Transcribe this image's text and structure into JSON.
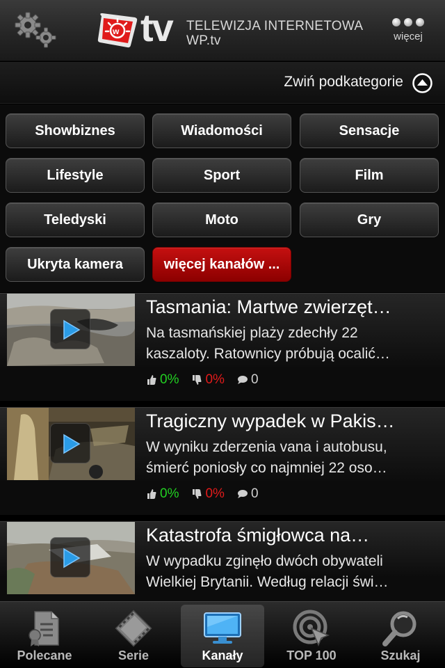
{
  "header": {
    "logo_text_line1": "TELEWIZJA INTERNETOWA",
    "logo_text_line2": "WP.tv",
    "logo_tv": "tv",
    "more_label": "więcej"
  },
  "subcategories": {
    "collapse_label": "Zwiń podkategorie"
  },
  "categories": [
    "Showbiznes",
    "Wiadomości",
    "Sensacje",
    "Lifestyle",
    "Sport",
    "Film",
    "Teledyski",
    "Moto",
    "Gry",
    "Ukryta kamera",
    "więcej kanałów ..."
  ],
  "videos": [
    {
      "title": "Tasmania: Martwe zwierzęt…",
      "desc_line1": "Na tasmańskiej plaży zdechły 22",
      "desc_line2": "kaszaloty. Ratownicy próbują ocalić…",
      "likes": "0%",
      "dislikes": "0%",
      "comments": "0"
    },
    {
      "title": "Tragiczny wypadek w Pakis…",
      "desc_line1": "W wyniku zderzenia vana i autobusu,",
      "desc_line2": "śmierć poniosły co najmniej 22 oso…",
      "likes": "0%",
      "dislikes": "0%",
      "comments": "0"
    },
    {
      "title": "Katastrofa śmigłowca na…",
      "desc_line1": "W wypadku zginęło dwóch obywateli",
      "desc_line2": "Wielkiej Brytanii. Według relacji świ…",
      "likes": "",
      "dislikes": "",
      "comments": ""
    }
  ],
  "tabs": [
    {
      "label": "Polecane",
      "icon": "document-icon",
      "active": false
    },
    {
      "label": "Serie",
      "icon": "film-icon",
      "active": false
    },
    {
      "label": "Kanały",
      "icon": "monitor-icon",
      "active": true
    },
    {
      "label": "TOP 100",
      "icon": "target-icon",
      "active": false
    },
    {
      "label": "Szukaj",
      "icon": "magnifier-icon",
      "active": false
    }
  ],
  "colors": {
    "accent_red": "#c51010",
    "like_green": "#22d022",
    "dislike_red": "#e21b1b"
  }
}
